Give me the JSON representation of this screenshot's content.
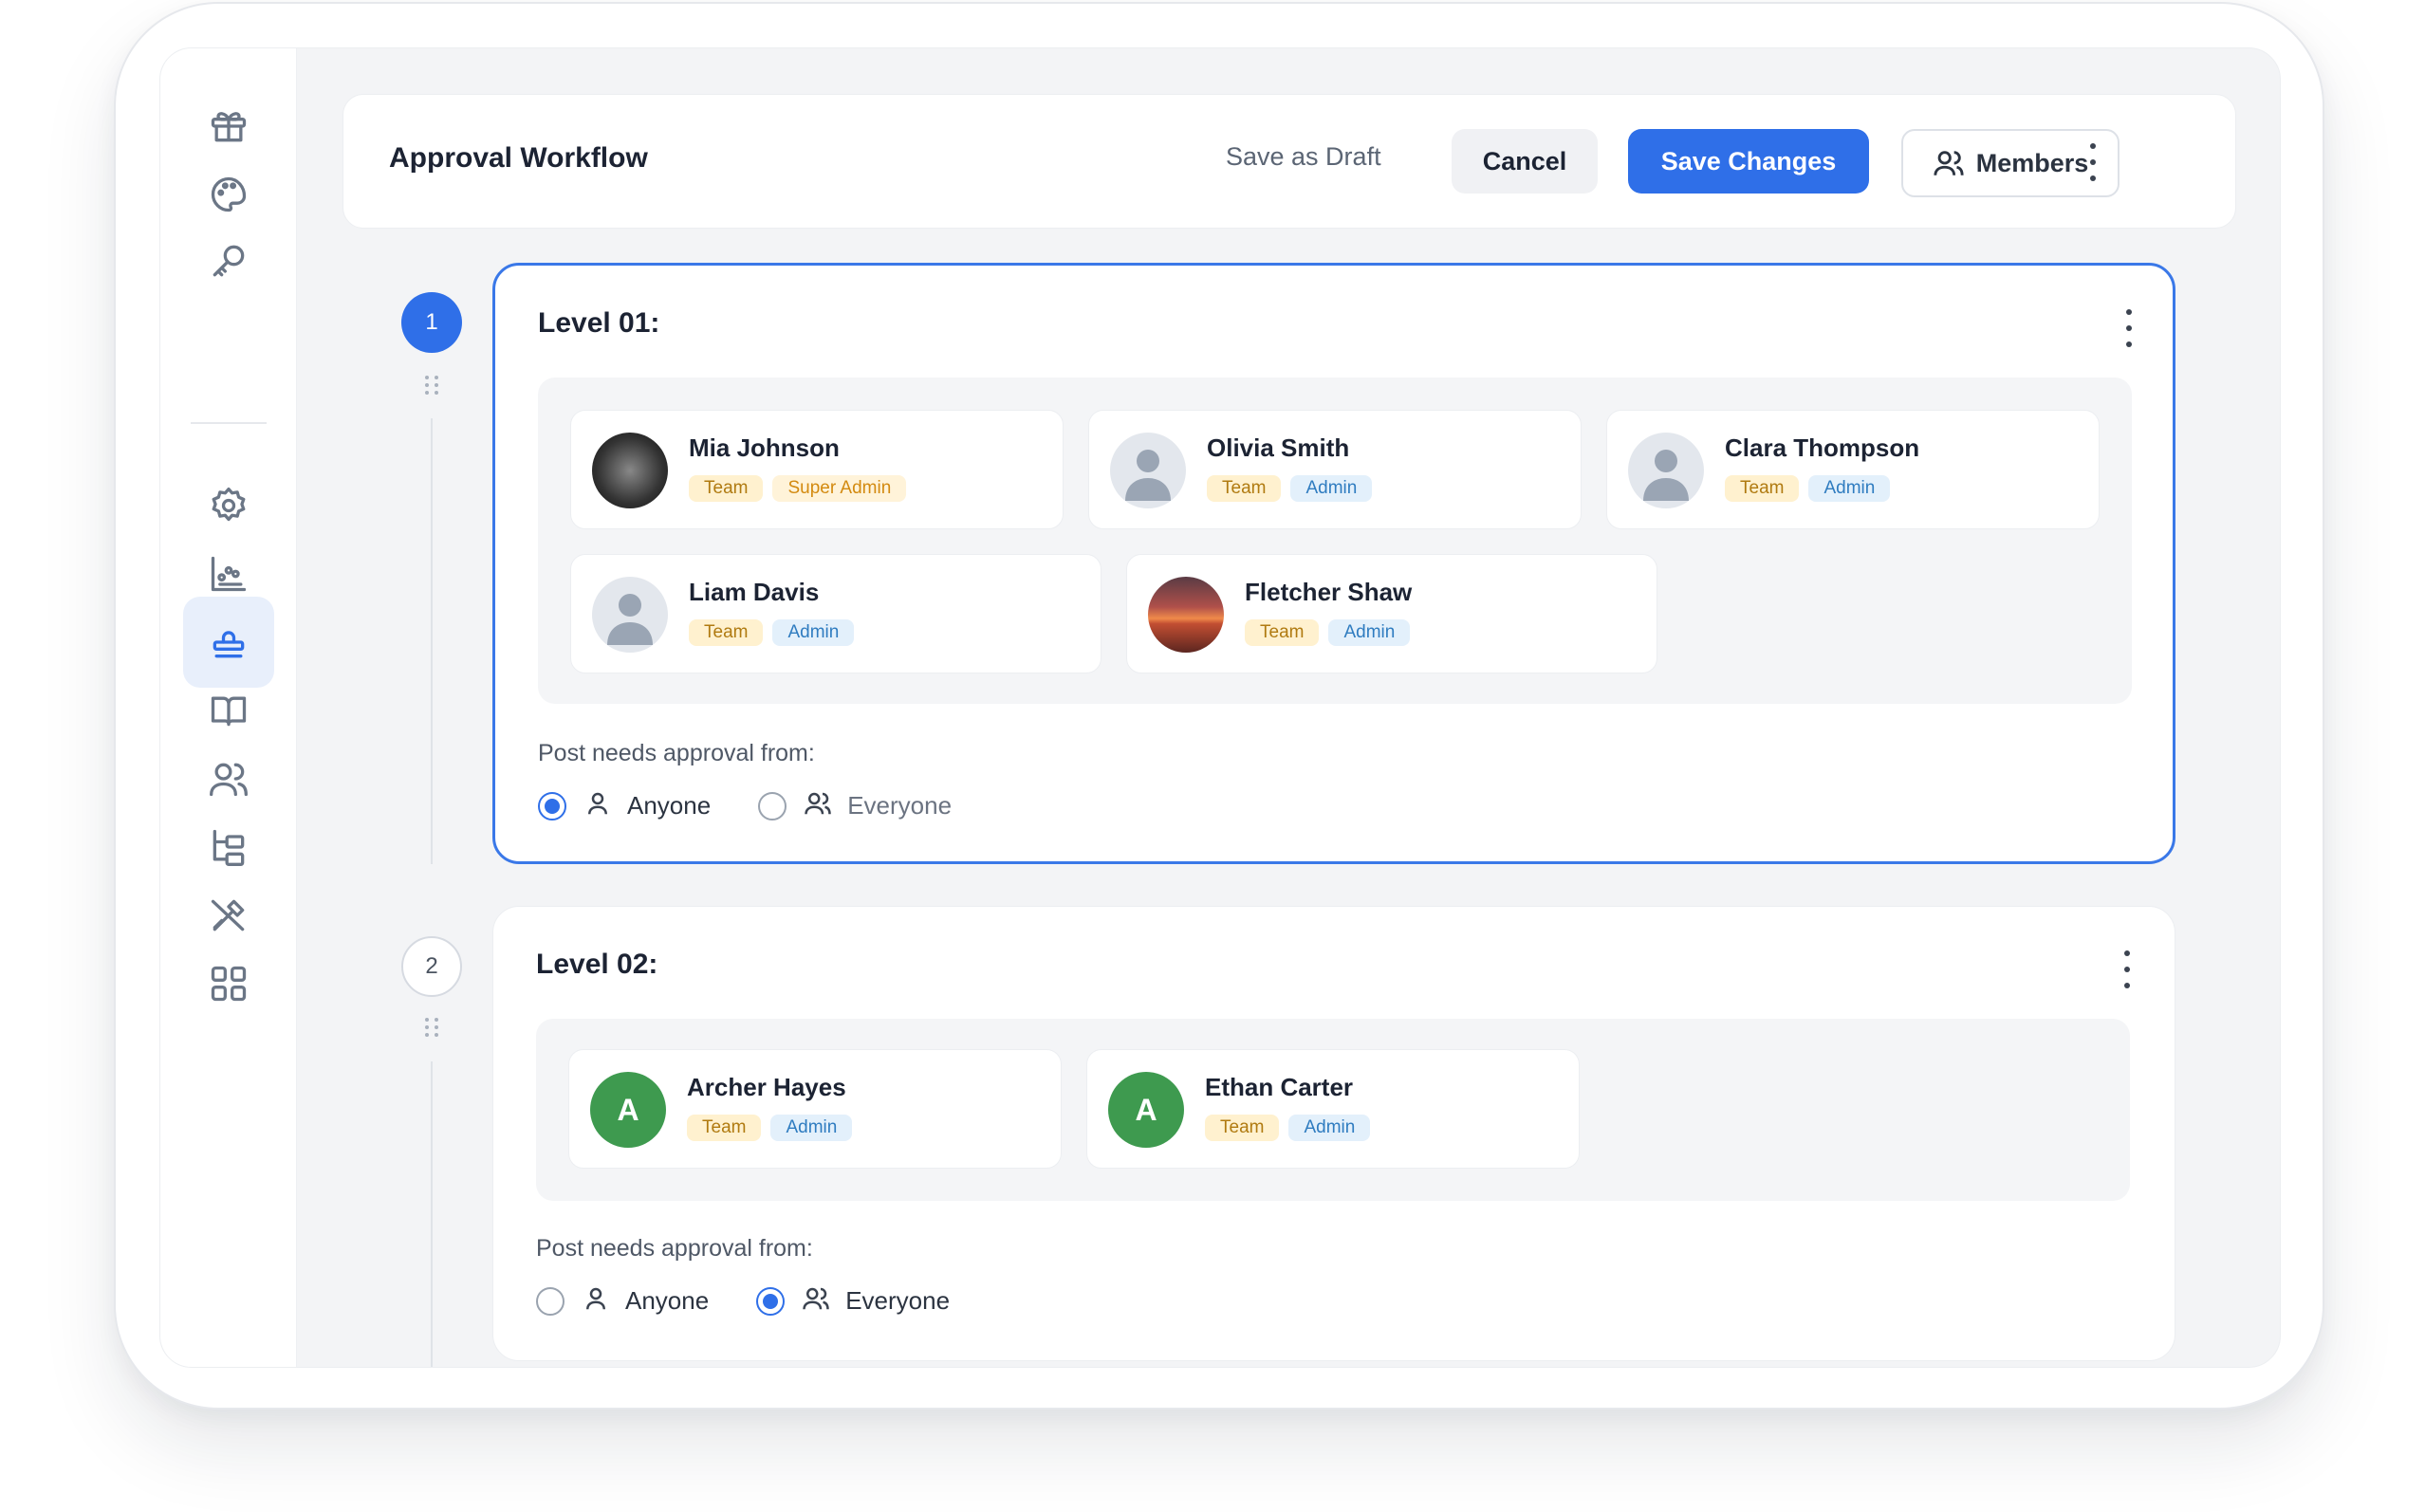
{
  "header": {
    "title": "Approval Workflow",
    "save_draft_label": "Save as Draft",
    "cancel_label": "Cancel",
    "save_changes_label": "Save Changes",
    "members_label": "Members"
  },
  "sidebar": {
    "items": [
      {
        "icon": "gift-icon"
      },
      {
        "icon": "palette-icon"
      },
      {
        "icon": "key-icon"
      },
      {
        "icon": "gear-icon"
      },
      {
        "icon": "chart-icon"
      },
      {
        "icon": "stamp-icon",
        "active": true
      },
      {
        "icon": "book-icon"
      },
      {
        "icon": "users-icon"
      },
      {
        "icon": "hierarchy-icon"
      },
      {
        "icon": "tools-icon"
      },
      {
        "icon": "grid-icon"
      }
    ]
  },
  "levels": [
    {
      "step": "1",
      "title": "Level 01:",
      "members": [
        {
          "name": "Mia Johnson",
          "tags": [
            "Team",
            "Super Admin"
          ]
        },
        {
          "name": "Olivia Smith",
          "tags": [
            "Team",
            "Admin"
          ]
        },
        {
          "name": "Clara Thompson",
          "tags": [
            "Team",
            "Admin"
          ]
        },
        {
          "name": "Liam Davis",
          "tags": [
            "Team",
            "Admin"
          ]
        },
        {
          "name": "Fletcher Shaw",
          "tags": [
            "Team",
            "Admin"
          ]
        }
      ],
      "approval_label": "Post needs approval from:",
      "options": [
        "Anyone",
        "Everyone"
      ],
      "selected": "Anyone"
    },
    {
      "step": "2",
      "title": "Level 02:",
      "members": [
        {
          "name": "Archer Hayes",
          "initial": "A",
          "tags": [
            "Team",
            "Admin"
          ]
        },
        {
          "name": "Ethan Carter",
          "initial": "A",
          "tags": [
            "Team",
            "Admin"
          ]
        }
      ],
      "approval_label": "Post needs approval from:",
      "options": [
        "Anyone",
        "Everyone"
      ],
      "selected": "Everyone"
    }
  ],
  "colors": {
    "accent": "#2f6fe8",
    "avatar_green": "#3e9a4f",
    "tag_team_bg": "#fff1cf",
    "tag_admin_bg": "#e3f0fb"
  }
}
